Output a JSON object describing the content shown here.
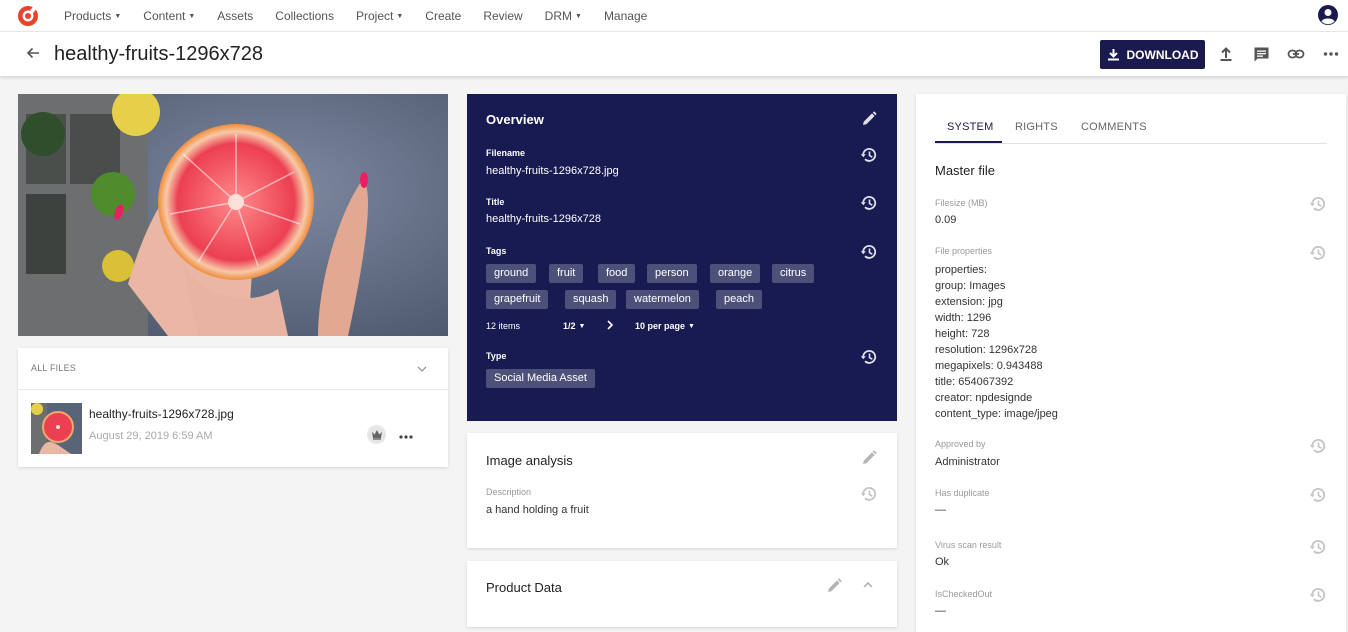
{
  "nav": {
    "items": [
      {
        "label": "Products",
        "dropdown": true
      },
      {
        "label": "Content",
        "dropdown": true
      },
      {
        "label": "Assets",
        "dropdown": false
      },
      {
        "label": "Collections",
        "dropdown": false
      },
      {
        "label": "Project",
        "dropdown": true
      },
      {
        "label": "Create",
        "dropdown": false
      },
      {
        "label": "Review",
        "dropdown": false
      },
      {
        "label": "DRM",
        "dropdown": true
      },
      {
        "label": "Manage",
        "dropdown": false
      }
    ]
  },
  "header": {
    "title": "healthy-fruits-1296x728",
    "download_label": "DOWNLOAD"
  },
  "files": {
    "label": "ALL FILES",
    "items": [
      {
        "name": "healthy-fruits-1296x728.jpg",
        "date": "August 29, 2019 6:59 AM"
      }
    ]
  },
  "overview": {
    "title": "Overview",
    "filename_label": "Filename",
    "filename": "healthy-fruits-1296x728.jpg",
    "title_label": "Title",
    "title_value": "healthy-fruits-1296x728",
    "tags_label": "Tags",
    "tags": [
      "ground",
      "fruit",
      "food",
      "person",
      "orange",
      "citrus",
      "grapefruit",
      "squash",
      "watermelon",
      "peach"
    ],
    "items_count": "12 items",
    "page": "1/2",
    "per_page": "10 per page",
    "type_label": "Type",
    "type_value": "Social Media Asset"
  },
  "image_analysis": {
    "title": "Image analysis",
    "description_label": "Description",
    "description": "a hand holding a fruit"
  },
  "product_data": {
    "title": "Product Data"
  },
  "side": {
    "tabs": [
      "SYSTEM",
      "RIGHTS",
      "COMMENTS"
    ],
    "active_tab": "SYSTEM",
    "section_title": "Master file",
    "filesize_label": "Filesize (MB)",
    "filesize": "0.09",
    "file_props_label": "File properties",
    "file_props": [
      "properties:",
      "group: Images",
      "extension: jpg",
      "width: 1296",
      "height: 728",
      "resolution: 1296x728",
      "megapixels: 0.943488",
      "title: 654067392",
      "creator: npdesignde",
      "content_type: image/jpeg"
    ],
    "approved_by_label": "Approved by",
    "approved_by": "Administrator",
    "duplicate_label": "Has duplicate",
    "duplicate": "—",
    "virus_label": "Virus scan result",
    "virus": "Ok",
    "checked_out_label": "IsCheckedOut",
    "checked_out": "—"
  },
  "colors": {
    "accent": "#1a1a4e",
    "overview_bg": "#181a52",
    "tag_bg": "#4d5179",
    "logo": "#e8412c"
  }
}
